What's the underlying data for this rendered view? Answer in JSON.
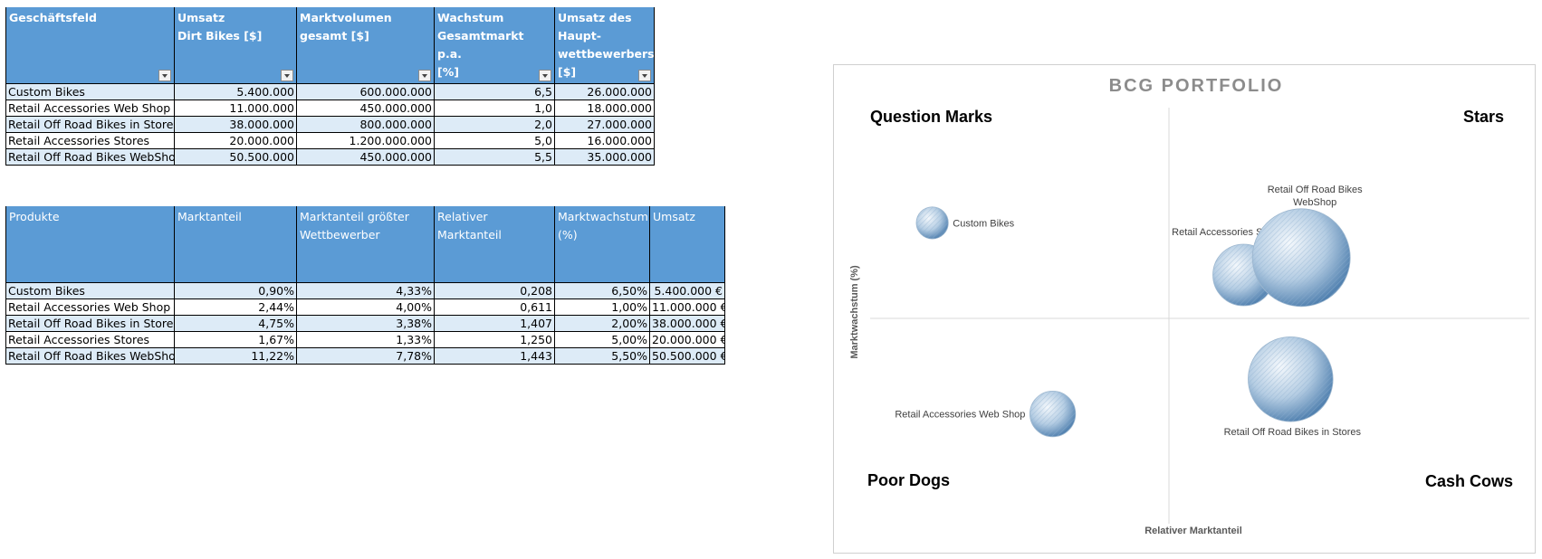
{
  "table1": {
    "headers": [
      [
        "Geschäftsfeld"
      ],
      [
        "Umsatz",
        "Dirt Bikes [$]"
      ],
      [
        "Marktvolumen",
        "gesamt [$]"
      ],
      [
        "Wachstum",
        "Gesamtmarkt p.a.",
        "[%]"
      ],
      [
        "Umsatz des",
        "Haupt-",
        "wettbewerbers",
        "[$]"
      ]
    ],
    "rows": [
      [
        "Custom Bikes",
        "5.400.000",
        "600.000.000",
        "6,5",
        "26.000.000"
      ],
      [
        "Retail Accessories Web Shop",
        "11.000.000",
        "450.000.000",
        "1,0",
        "18.000.000"
      ],
      [
        "Retail Off Road Bikes in Stores",
        "38.000.000",
        "800.000.000",
        "2,0",
        "27.000.000"
      ],
      [
        "Retail Accessories Stores",
        "20.000.000",
        "1.200.000.000",
        "5,0",
        "16.000.000"
      ],
      [
        "Retail Off Road Bikes WebShop",
        "50.500.000",
        "450.000.000",
        "5,5",
        "35.000.000"
      ]
    ]
  },
  "table2": {
    "headers": [
      [
        "Produkte"
      ],
      [
        "Marktanteil"
      ],
      [
        "Marktanteil größter",
        "Wettbewerber"
      ],
      [
        "Relativer",
        "Marktanteil"
      ],
      [
        "Marktwachstum",
        "(%)"
      ],
      [
        "Umsatz"
      ]
    ],
    "rows": [
      [
        "Custom Bikes",
        "0,90%",
        "4,33%",
        "0,208",
        "6,50%",
        "5.400.000 €"
      ],
      [
        "Retail Accessories Web Shop",
        "2,44%",
        "4,00%",
        "0,611",
        "1,00%",
        "11.000.000 €"
      ],
      [
        "Retail Off Road Bikes in Stores",
        "4,75%",
        "3,38%",
        "1,407",
        "2,00%",
        "38.000.000 €"
      ],
      [
        "Retail Accessories Stores",
        "1,67%",
        "1,33%",
        "1,250",
        "5,00%",
        "20.000.000 €"
      ],
      [
        "Retail Off Road Bikes WebShop",
        "11,22%",
        "7,78%",
        "1,443",
        "5,50%",
        "50.500.000 €"
      ]
    ]
  },
  "chart_data": {
    "type": "bubble",
    "title": "BCG PORTFOLIO",
    "xlabel": "Relativer Marktanteil",
    "ylabel": "Marktwachstum (%)",
    "xlim": [
      0,
      2
    ],
    "ylim": [
      -2.5,
      10
    ],
    "quadrant_divider_x": 1,
    "quadrant_divider_y": 3.75,
    "quadrants": {
      "top_left": "Question Marks",
      "top_right": "Stars",
      "bottom_left": "Poor Dogs",
      "bottom_right": "Cash Cows"
    },
    "points": [
      {
        "label": "Custom Bikes",
        "x": 0.208,
        "y": 6.5,
        "size": 5400000,
        "label_pos": "right"
      },
      {
        "label": "Retail Accessories Web Shop",
        "x": 0.611,
        "y": 1.0,
        "size": 11000000,
        "label_pos": "left"
      },
      {
        "label": "Retail Off Road Bikes in Stores",
        "x": 1.407,
        "y": 2.0,
        "size": 38000000,
        "label_pos": "below"
      },
      {
        "label": "Retail Accessories Stores",
        "x": 1.25,
        "y": 5.0,
        "size": 20000000,
        "label_pos": "above-left"
      },
      {
        "label": "Retail Off Road Bikes WebShop",
        "x": 1.443,
        "y": 5.5,
        "size": 50500000,
        "label_pos": "above-right"
      }
    ],
    "legend": "none",
    "grid": false,
    "colors": {
      "bubble_light": "#f4f8fc",
      "bubble_mid": "#b5cde3",
      "bubble_dark": "#4f7fae",
      "hatch": "#8fb0d0"
    }
  }
}
